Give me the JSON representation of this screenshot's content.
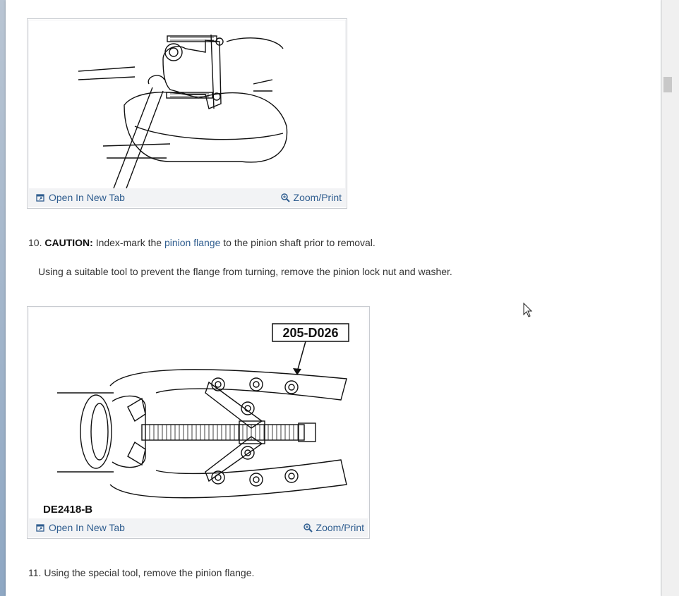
{
  "figures": [
    {
      "open_label": "Open In New Tab",
      "zoom_label": "Zoom/Print"
    },
    {
      "tool_callout": "205-D026",
      "figure_code": "DE2418-B",
      "open_label": "Open In New Tab",
      "zoom_label": "Zoom/Print"
    }
  ],
  "step10": {
    "number": "10.",
    "caution_label": "CAUTION:",
    "text_before": "Index-mark the",
    "link_text": "pinion flange",
    "text_after": "to the pinion shaft prior to removal.",
    "detail": "Using a suitable tool to prevent the flange from turning, remove the pinion lock nut and washer."
  },
  "step11": {
    "number": "11.",
    "text": "Using the special tool, remove the pinion flange."
  },
  "colors": {
    "link": "#2f5d8f",
    "figure_bar": "#f2f3f5"
  },
  "icons": {
    "open": "open-new-tab-icon",
    "zoom": "zoom-icon"
  }
}
